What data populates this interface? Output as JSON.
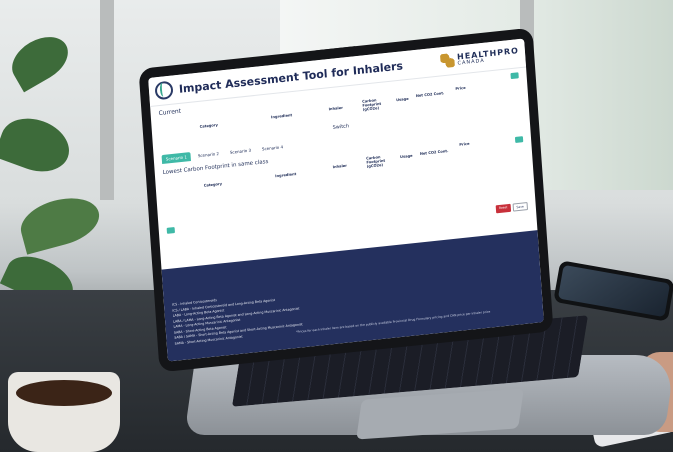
{
  "app": {
    "title": "Impact Assessment Tool for Inhalers",
    "brand_name": "HEALTHPRO",
    "brand_sub": "CANADA"
  },
  "current": {
    "title": "Current",
    "columns": [
      "Category",
      "Ingredient",
      "Inhaler",
      "Carbon Footprint (gCO2e)",
      "Usage",
      "Net CO2 Cont.",
      "Price"
    ]
  },
  "switch_label": "Switch",
  "tabs": [
    "Scenario 1",
    "Scenario 2",
    "Scenario 3",
    "Scenario 4"
  ],
  "lowest": {
    "title": "Lowest Carbon Footprint in same class",
    "columns": [
      "Category",
      "Ingredient",
      "Inhaler",
      "Carbon Footprint (gCO2e)",
      "Usage",
      "Net CO2 Cont.",
      "Price"
    ],
    "btn_red": "Reset",
    "btn_white": "Save"
  },
  "legend": [
    "ICS - Inhaled Corticosteroids",
    "ICS / LABA - Inhaled Corticosteroid and Long-Acting Beta Agonist",
    "LABA - Long-Acting Beta Agonist",
    "LABA / LAMA - Long-Acting Beta Agonist and Long-Acting Muscarinic Antagonist",
    "LAMA - Long-Acting Muscarinic Antagonist",
    "SABA - Short-Acting Beta Agonist",
    "SABA / SAMA - Short-Acting Beta Agonist and Short-Acting Muscarinic Antagonist",
    "SAMA - Short-Acting Muscarinic Antagonist"
  ],
  "footnote": "*Prices for each inhaler item are based on the publicly available Provincial Drug Formulary pricing and CAN price per inhaler price",
  "colors": {
    "accent": "#3fb9a7",
    "navy": "#24305e",
    "red": "#c8303a",
    "brand_gold": "#c8962f"
  }
}
